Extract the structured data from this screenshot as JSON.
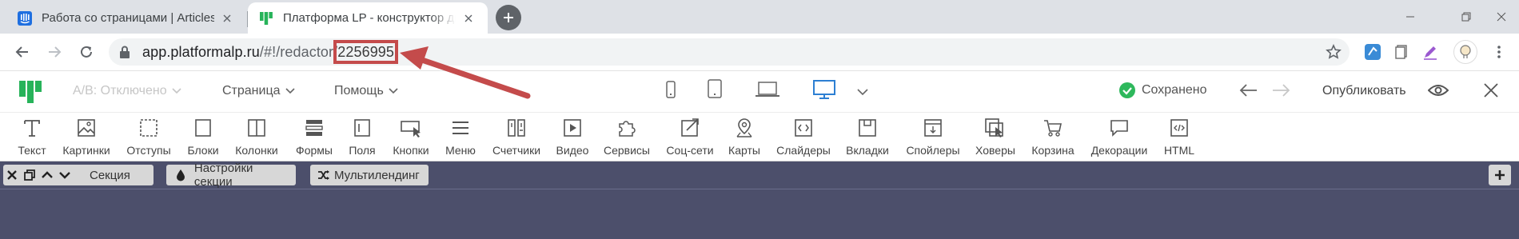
{
  "browser": {
    "tabs": [
      {
        "title": "Работа со страницами | Articles",
        "favicon": "intercom-icon",
        "active": false
      },
      {
        "title": "Платформа LP - конструктор ди",
        "favicon": "platformalp-icon",
        "active": true
      }
    ],
    "url": {
      "host": "app.platformalp.ru",
      "path": "/#!/redactor/",
      "page_id": "2256995"
    },
    "annotation": {
      "color": "#c44b4b",
      "target": "page_id"
    }
  },
  "appbar": {
    "ab_label": "A/B: Отключено",
    "page_menu": "Страница",
    "help_menu": "Помощь",
    "devices": [
      "mobile-icon",
      "tablet-icon",
      "laptop-icon",
      "desktop-icon"
    ],
    "active_device": "desktop-icon",
    "saved_status": "Сохранено",
    "publish_label": "Опубликовать",
    "accent_color": "#2eb85c",
    "device_active_color": "#2d7fd3"
  },
  "toolbar": {
    "tools": [
      {
        "label": "Текст",
        "icon": "text-icon"
      },
      {
        "label": "Картинки",
        "icon": "image-icon"
      },
      {
        "label": "Отступы",
        "icon": "spacing-icon"
      },
      {
        "label": "Блоки",
        "icon": "block-icon"
      },
      {
        "label": "Колонки",
        "icon": "columns-icon"
      },
      {
        "label": "Формы",
        "icon": "forms-icon"
      },
      {
        "label": "Поля",
        "icon": "fields-icon"
      },
      {
        "label": "Кнопки",
        "icon": "buttons-icon"
      },
      {
        "label": "Меню",
        "icon": "menu-icon"
      },
      {
        "label": "Счетчики",
        "icon": "counters-icon"
      },
      {
        "label": "Видео",
        "icon": "video-icon"
      },
      {
        "label": "Сервисы",
        "icon": "puzzle-icon"
      },
      {
        "label": "Соц-сети",
        "icon": "share-icon"
      },
      {
        "label": "Карты",
        "icon": "map-pin-icon"
      },
      {
        "label": "Слайдеры",
        "icon": "slider-icon"
      },
      {
        "label": "Вкладки",
        "icon": "tabs-icon"
      },
      {
        "label": "Спойлеры",
        "icon": "spoiler-icon"
      },
      {
        "label": "Ховеры",
        "icon": "hover-icon"
      },
      {
        "label": "Корзина",
        "icon": "cart-icon"
      },
      {
        "label": "Декорации",
        "icon": "decoration-icon"
      },
      {
        "label": "HTML",
        "icon": "html-icon"
      }
    ]
  },
  "section": {
    "section_label": "Секция",
    "settings_label": "Настройки секции",
    "multilanding_label": "Мультилендинг",
    "canvas_color": "#4c4f6b"
  }
}
